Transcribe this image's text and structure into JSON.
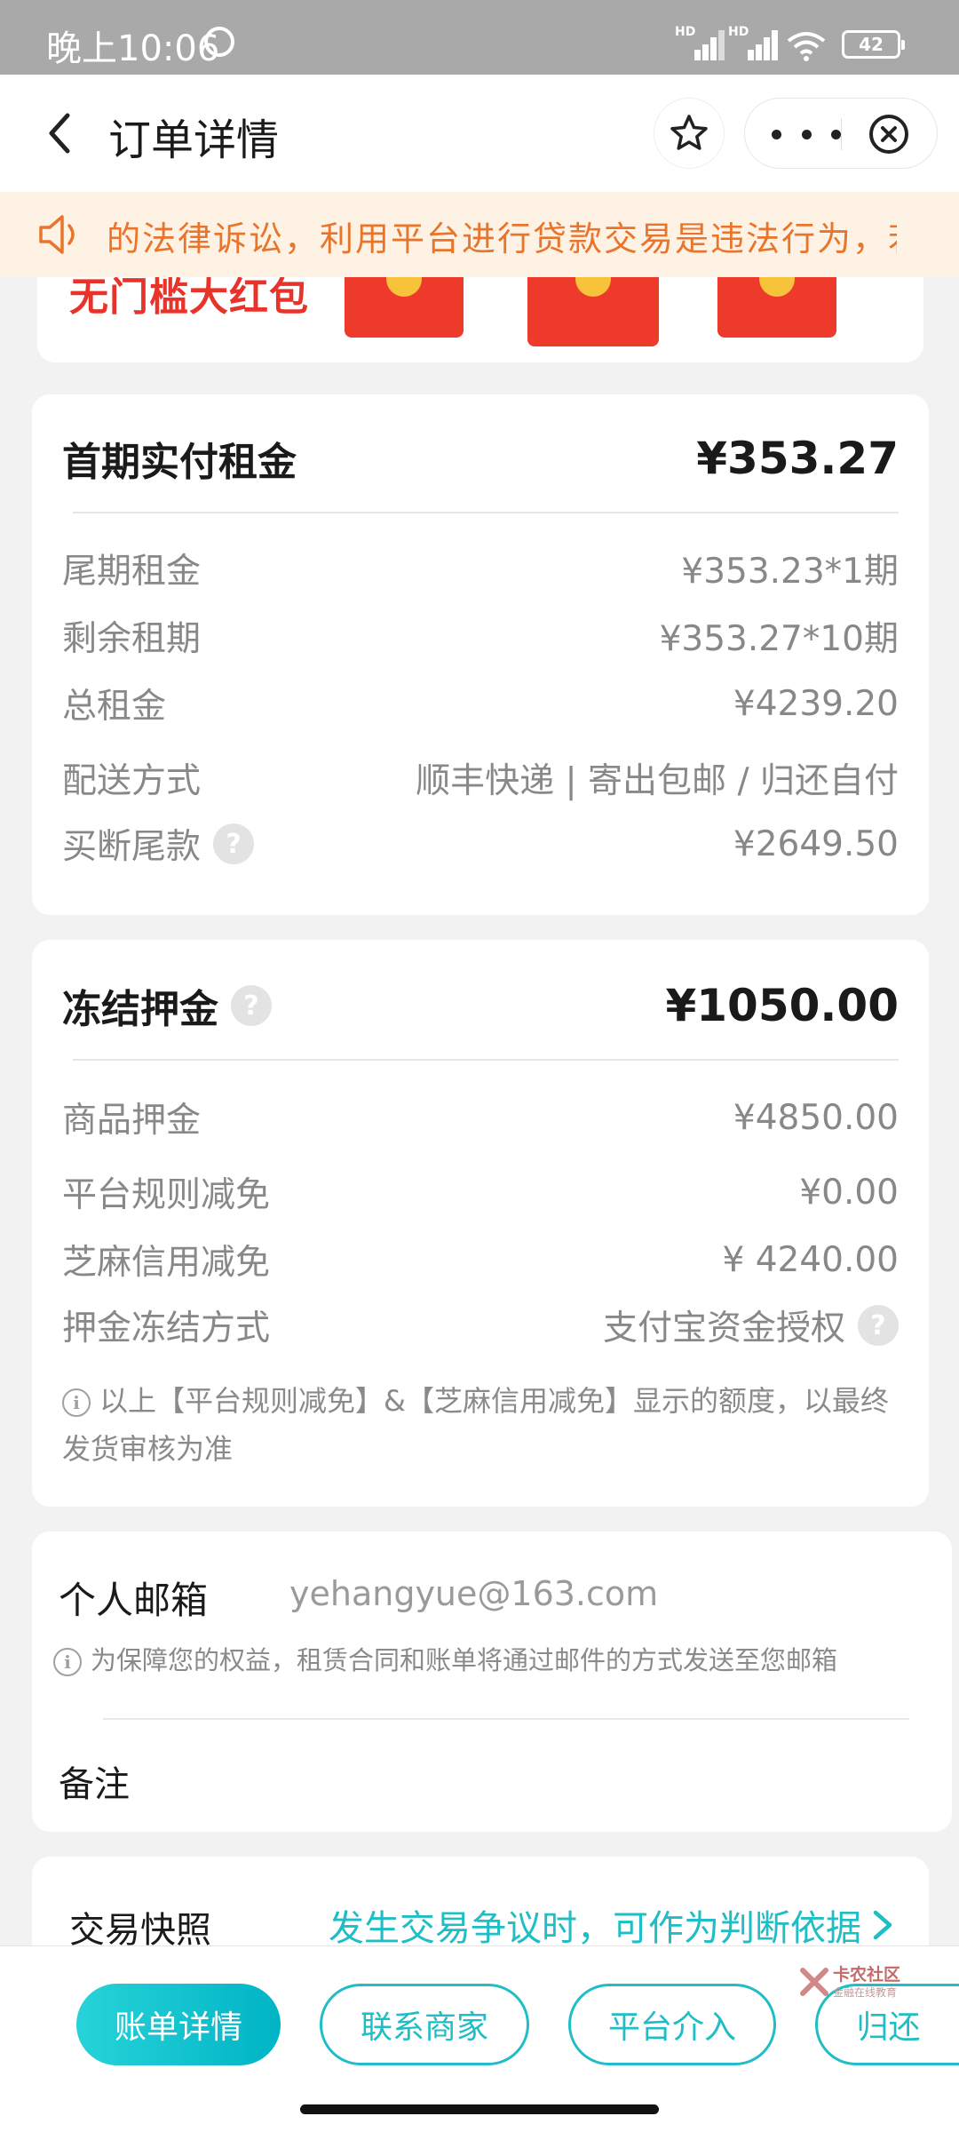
{
  "status_bar": {
    "time": "晚上10:06",
    "battery": "42"
  },
  "navbar": {
    "title": "订单详情"
  },
  "notice": {
    "text": "的法律诉讼，利用平台进行贷款交易是违法行为，若发"
  },
  "promo": {
    "text": "无门槛大红包"
  },
  "rent_card": {
    "head_label": "首期实付租金",
    "head_value": "¥353.27",
    "rows": [
      {
        "label": "尾期租金",
        "value": "¥353.23*1期"
      },
      {
        "label": "剩余租期",
        "value": "¥353.27*10期"
      },
      {
        "label": "总租金",
        "value": "¥4239.20"
      },
      {
        "label": "配送方式",
        "value": "顺丰快递 | 寄出包邮 / 归还自付"
      },
      {
        "label": "买断尾款",
        "value": "¥2649.50"
      }
    ]
  },
  "deposit_card": {
    "head_label": "冻结押金",
    "head_value": "¥1050.00",
    "rows": [
      {
        "label": "商品押金",
        "value": "¥4850.00"
      },
      {
        "label": "平台规则减免",
        "value": "¥0.00"
      },
      {
        "label": "芝麻信用减免",
        "value": "¥ 4240.00"
      },
      {
        "label": "押金冻结方式",
        "value": "支付宝资金授权"
      }
    ],
    "note_line1": "以上【平台规则减免】&【芝麻信用减免】显示的额度，以最终",
    "note_line2": "发货审核为准"
  },
  "email_card": {
    "email_label": "个人邮箱",
    "email_value": "yehangyue@163.com",
    "email_note": "为保障您的权益，租赁合同和账单将通过邮件的方式发送至您邮箱",
    "remark_label": "备注"
  },
  "snapshot": {
    "label": "交易快照",
    "link": "发生交易争议时，可作为判断依据"
  },
  "bottom_buttons": {
    "bill": "账单详情",
    "contact": "联系商家",
    "platform": "平台介入",
    "return": "归还"
  },
  "watermark": {
    "main": "卡农社区",
    "sub": "金融在线教育"
  },
  "colors": {
    "accent": "#1fbdc5",
    "notice_text": "#e8752b",
    "notice_bg": "#fdf2e4",
    "promo_red": "#e8332b"
  },
  "icons": [
    "back-arrow-icon",
    "star-icon",
    "more-dots-icon",
    "close-circle-icon",
    "speaker-icon",
    "question-icon",
    "info-icon",
    "chevron-right-icon"
  ]
}
